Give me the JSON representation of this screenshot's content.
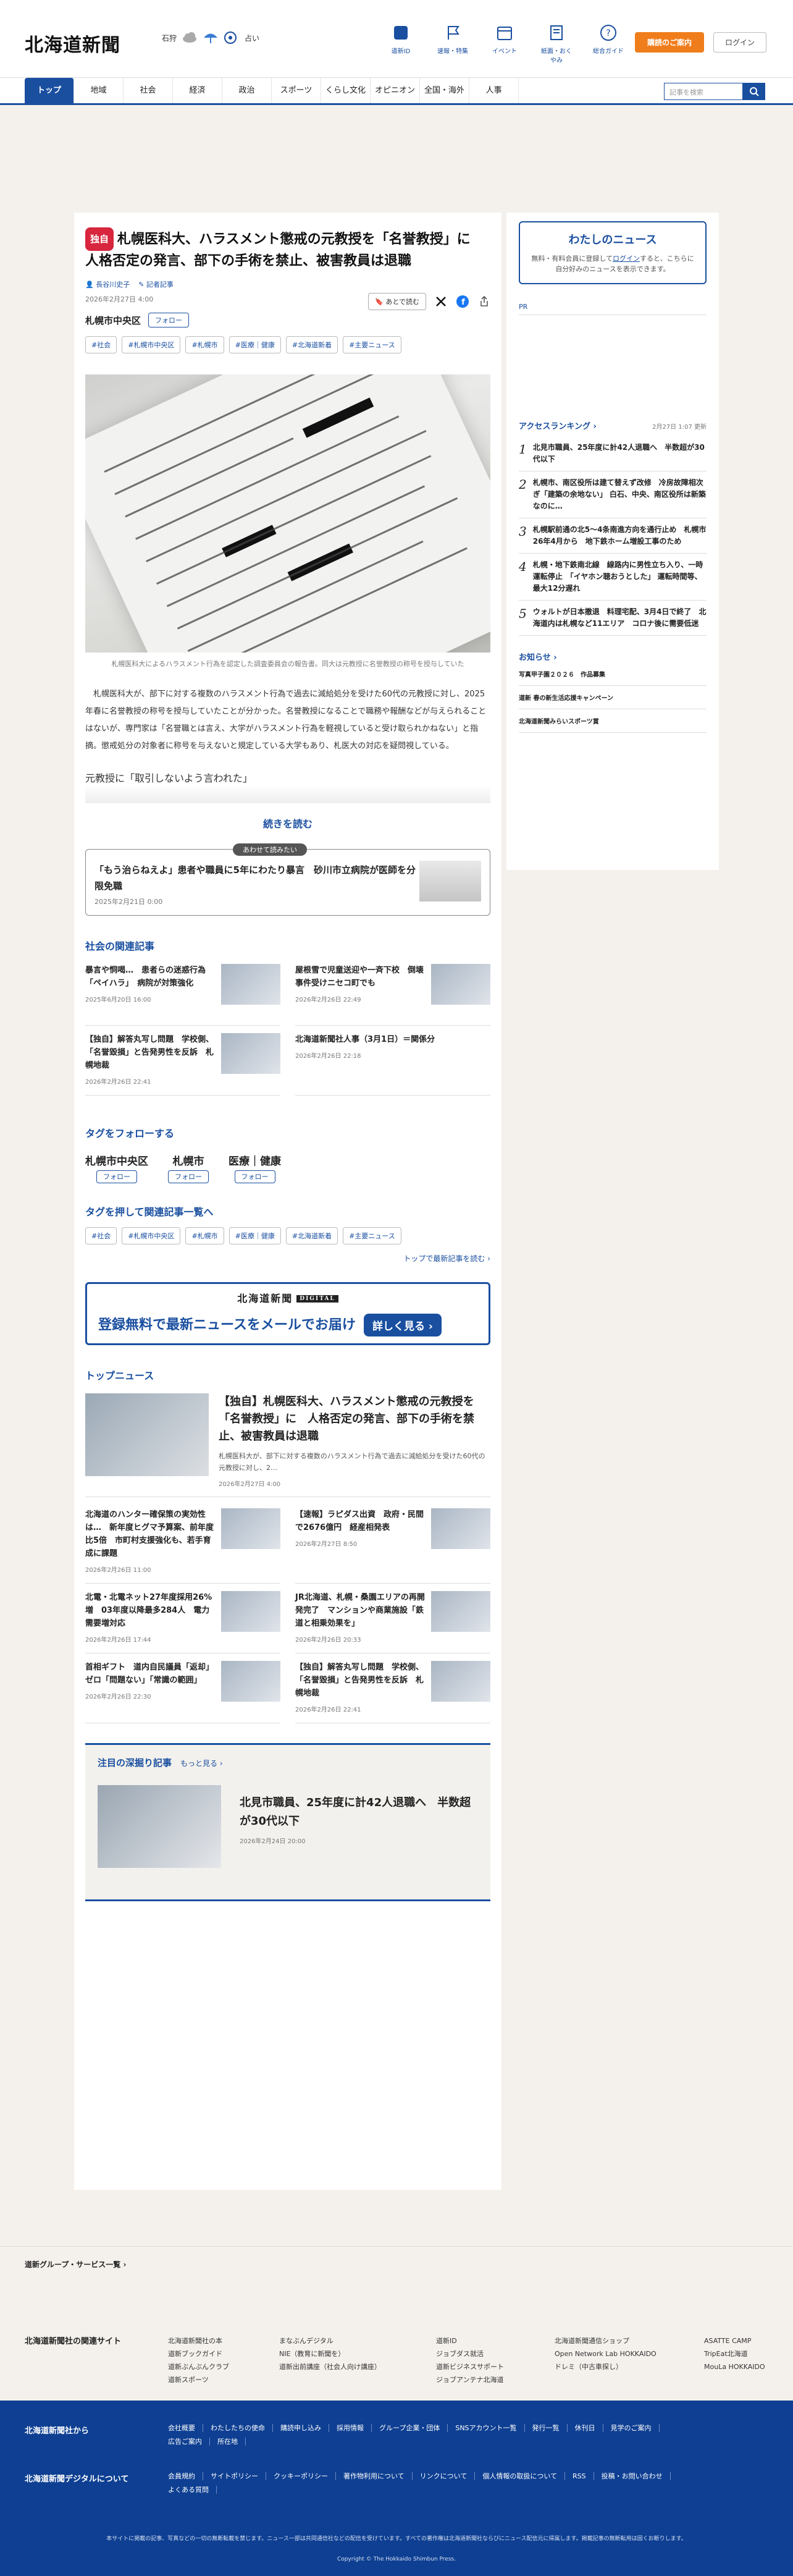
{
  "header": {
    "logo": "北海道新聞",
    "weather": {
      "place": "石狩",
      "label": "占い"
    },
    "nav": [
      {
        "label": "道新ID",
        "icon": "id-icon"
      },
      {
        "label": "速報・特集",
        "icon": "flag-icon"
      },
      {
        "label": "イベント",
        "icon": "calendar-icon"
      },
      {
        "label": "紙面・おくやみ",
        "icon": "newspaper-icon"
      },
      {
        "label": "総合ガイド",
        "icon": "question-icon"
      }
    ],
    "subscribe": "購読のご案内",
    "login": "ログイン"
  },
  "tabs": [
    "トップ",
    "地域",
    "社会",
    "経済",
    "政治",
    "スポーツ",
    "くらし文化",
    "オピニオン",
    "全国・海外",
    "人事"
  ],
  "search": {
    "placeholder": "記事を検索"
  },
  "article": {
    "badge": "独自",
    "title": "札幌医科大、ハラスメント懲戒の元教授を「名誉教授」に　人格否定の発言、部下の手術を禁止、被害教員は退職",
    "author": "長谷川史子",
    "author_link": "記者記事",
    "date": "2026年2月27日 4:00",
    "later": "あとで読む",
    "location": "札幌市中央区",
    "follow": "フォロー",
    "tags": [
      "#社会",
      "#札幌市中央区",
      "#札幌市",
      "#医療｜健康",
      "#北海道新着",
      "#主要ニュース"
    ],
    "caption": "札幌医科大によるハラスメント行為を認定した調査委員会の報告書。同大は元教授に名誉教授の称号を授与していた",
    "body": "札幌医科大が、部下に対する複数のハラスメント行為で過去に減給処分を受けた60代の元教授に対し、2025年春に名誉教授の称号を授与していたことが分かった。名誉教授になることで職務や報酬などが与えられることはないが、専門家は「名誉職とは言え、大学がハラスメント行為を軽視していると受け取られかねない」と指摘。懲戒処分の対象者に称号を与えないと規定している大学もあり、札医大の対応を疑問視している。",
    "subhead": "元教授に「取引しないよう言われた」",
    "read_more": "続きを読む"
  },
  "also_read": {
    "label": "あわせて読みたい",
    "title": "「もう治らねえよ」患者や職員に5年にわたり暴言　砂川市立病院が医師を分限免職",
    "date": "2025年2月21日 0:00"
  },
  "related": {
    "heading": "社会の関連記事",
    "items": [
      {
        "title": "暴言や恫喝…　患者らの迷惑行為「ペイハラ」　病院が対策強化",
        "date": "2025年6月20日 16:00"
      },
      {
        "title": "屋根雪で児童送迎や一斉下校　倒壊事件受けニセコ町でも",
        "date": "2026年2月26日 22:49"
      },
      {
        "title": "【独自】解答丸写し問題　学校側、「名誉毀損」と告発男性を反訴　札幌地裁",
        "date": "2026年2月26日 22:41"
      },
      {
        "title": "北海道新聞社人事（3月1日）＝関係分",
        "date": "2026年2月26日 22:18"
      }
    ]
  },
  "follow_tags": {
    "heading": "タグをフォローする",
    "items": [
      "札幌市中央区",
      "札幌市",
      "医療｜健康"
    ],
    "button": "フォロー"
  },
  "tag_list": {
    "heading": "タグを押して関連記事一覧へ",
    "more": "トップで最新記事を読む"
  },
  "banner": {
    "logo": "北海道新聞",
    "digital": "DIGITAL",
    "text": "登録無料で最新ニュースをメールでお届け",
    "button": "詳しく見る"
  },
  "top_news": {
    "heading": "トップニュース",
    "lead": {
      "title": "【独自】札幌医科大、ハラスメント懲戒の元教授を「名誉教授」に　人格否定の発言、部下の手術を禁止、被害教員は退職",
      "summary": "札幌医科大が、部下に対する複数のハラスメント行為で過去に減給処分を受けた60代の元教授に対し、2…",
      "date": "2026年2月27日 4:00"
    },
    "items": [
      {
        "title": "北海道のハンター確保策の実効性は…　新年度ヒグマ予算案、前年度比5倍　市町村支援強化も、若手育成に課題",
        "date": "2026年2月26日 11:00"
      },
      {
        "title": "【速報】ラピダス出資　政府・民間で2676億円　経産相発表",
        "date": "2026年2月27日 8:50"
      },
      {
        "title": "北電・北電ネット27年度採用26%増　03年度以降最多284人　電力需要増対応",
        "date": "2026年2月26日 17:44"
      },
      {
        "title": "JR北海道、札幌・桑園エリアの再開発完了　マンションや商業施設「鉄道と相乗効果を」",
        "date": "2026年2月26日 20:33"
      },
      {
        "title": "首相ギフト　道内自民議員「返却」ゼロ「問題ない」「常識の範囲」",
        "date": "2026年2月26日 22:30"
      },
      {
        "title": "【独自】解答丸写し問題　学校側、「名誉毀損」と告発男性を反訴　札幌地裁",
        "date": "2026年2月26日 22:41"
      }
    ]
  },
  "deep": {
    "heading": "注目の深掘り記事",
    "more": "もっと見る",
    "title": "北見市職員、25年度に計42人退職へ　半数超が30代以下",
    "date": "2026年2月24日 20:00"
  },
  "sidebar": {
    "my_news": {
      "title": "わたしのニュース",
      "text_before": "無料・有料会員に登録して",
      "link": "ログイン",
      "text_after": "すると、こちらに自分好みのニュースを表示できます。"
    },
    "pr": "PR",
    "ranking": {
      "heading": "アクセスランキング",
      "date": "2月27日 1:07 更新",
      "items": [
        "北見市職員、25年度に計42人退職へ　半数超が30代以下",
        "札幌市、南区役所は建て替えず改修　冷房故障相次ぎ「建築の余地ない」 白石、中央、南区役所は新築なのに…",
        "札幌駅前通の北5〜4条南進方向を通行止め　札幌市26年4月から　地下鉄ホーム増設工事のため",
        "札幌・地下鉄南北線　線路内に男性立ち入り、一時運転停止　「イヤホン聴おうとした」 運転時間等、最大12分遅れ",
        "ウォルトが日本撤退　料理宅配、3月4日で終了　北海道内は札幌など11エリア　コロナ後に需要低迷"
      ]
    },
    "info": {
      "heading": "お知らせ",
      "items": [
        "写真甲子園２０２６　作品募集",
        "道新 春の新生活応援キャンペーン",
        "北海道新聞みらいスポーツ賞"
      ]
    }
  },
  "footer": {
    "group": "道新グループ・サービス一覧",
    "sites_heading": "北海道新聞社の関連サイト",
    "sites": [
      [
        "北海道新聞社の本",
        "道新ブックガイド",
        "道新ぶんぶんクラブ",
        "道新スポーツ"
      ],
      [
        "まなぶんデジタル",
        "NIE（教育に新聞を）",
        "道新出前講座（社会人向け講座）"
      ],
      [
        "道新ID",
        "ジョブダス就活",
        "道新ビジネスサポート",
        "ジョブアンテナ北海道"
      ],
      [
        "北海道新聞通信ショップ",
        "Open Network Lab HOKKAIDO",
        "ドレミ（中古車探し）"
      ],
      [
        "ASATTE CAMP",
        "TripEat北海道",
        "MouLa HOKKAIDO"
      ]
    ],
    "from_heading": "北海道新聞社から",
    "from_links": [
      "会社概要",
      "わたしたちの使命",
      "購読申し込み",
      "採用情報",
      "グループ企業・団体",
      "SNSアカウント一覧",
      "発行一覧",
      "休刊日",
      "見学のご案内",
      "広告ご案内",
      "所在地"
    ],
    "digital_heading": "北海道新聞デジタルについて",
    "digital_links": [
      "会員規約",
      "サイトポリシー",
      "クッキーポリシー",
      "著作物利用について",
      "リンクについて",
      "個人情報の取扱について",
      "RSS",
      "投稿・お問い合わせ",
      "よくある質問"
    ],
    "note": "本サイトに掲載の記事、写真などの一切の無断転載を禁じます。ニュース一部は共同通信社などの配信を受けています。すべての著作権は北海道新聞社ならびにニュース配信元に帰属します。掲載記事の無断転用は固くお断りします。",
    "copyright": "Copyright © The Hokkaido Shimbun Press."
  },
  "colors": {
    "accent": "#1a4fa0",
    "badge": "#d7263d",
    "subscribe": "#f07d1b",
    "footer": "#0e3f92"
  }
}
